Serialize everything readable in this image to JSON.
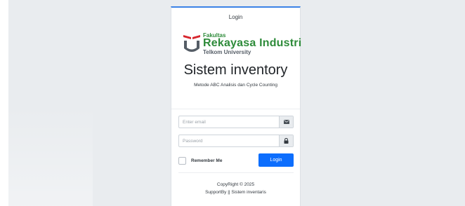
{
  "card": {
    "header": "Login",
    "logo": {
      "line1": "Fakultas",
      "line2": "Rekayasa Industri",
      "line3": "Telkom University"
    },
    "title": "Sistem inventory",
    "subtitle": "Metode ABC Analisis dan Cycle Counting"
  },
  "form": {
    "email_placeholder": "Enter email",
    "password_placeholder": "Password",
    "remember_label": "Remember Me",
    "login_label": "Login"
  },
  "footer": {
    "copyright": "CopyRight © 2025",
    "support": "SupportBy || Sistem inventaris"
  },
  "icons": {
    "email": "envelope-icon",
    "password": "lock-icon"
  },
  "colors": {
    "accent": "#0d6efd",
    "card_top_border": "#3b82e6",
    "logo_green": "#2e8b3a",
    "logo_red": "#d7262e",
    "background": "#e9ecef"
  }
}
